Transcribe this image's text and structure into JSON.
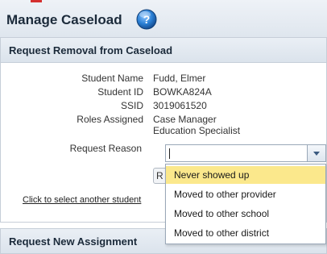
{
  "header": {
    "title": "Manage Caseload",
    "help_icon": "help-question-icon"
  },
  "removal_panel": {
    "title": "Request Removal from Caseload",
    "fields": {
      "student_name_label": "Student Name",
      "student_name_value": "Fudd, Elmer",
      "student_id_label": "Student ID",
      "student_id_value": "BOWKA824A",
      "ssid_label": "SSID",
      "ssid_value": "3019061520",
      "roles_label": "Roles Assigned",
      "roles_value_1": "Case Manager",
      "roles_value_2": "Education Specialist",
      "reason_label": "Request Reason"
    },
    "button_stub": "R",
    "select_link": "Click to select another student"
  },
  "reason_dropdown": {
    "value": "",
    "options": [
      "Never showed up",
      "Moved to other provider",
      "Moved to other school",
      "Moved to other district"
    ],
    "highlighted": "Never showed up"
  },
  "assignment_panel": {
    "title": "Request New Assignment"
  },
  "colors": {
    "highlight": "#fbe88c",
    "header_bg": "#dfe6ee",
    "help_blue": "#2a7fd4"
  }
}
